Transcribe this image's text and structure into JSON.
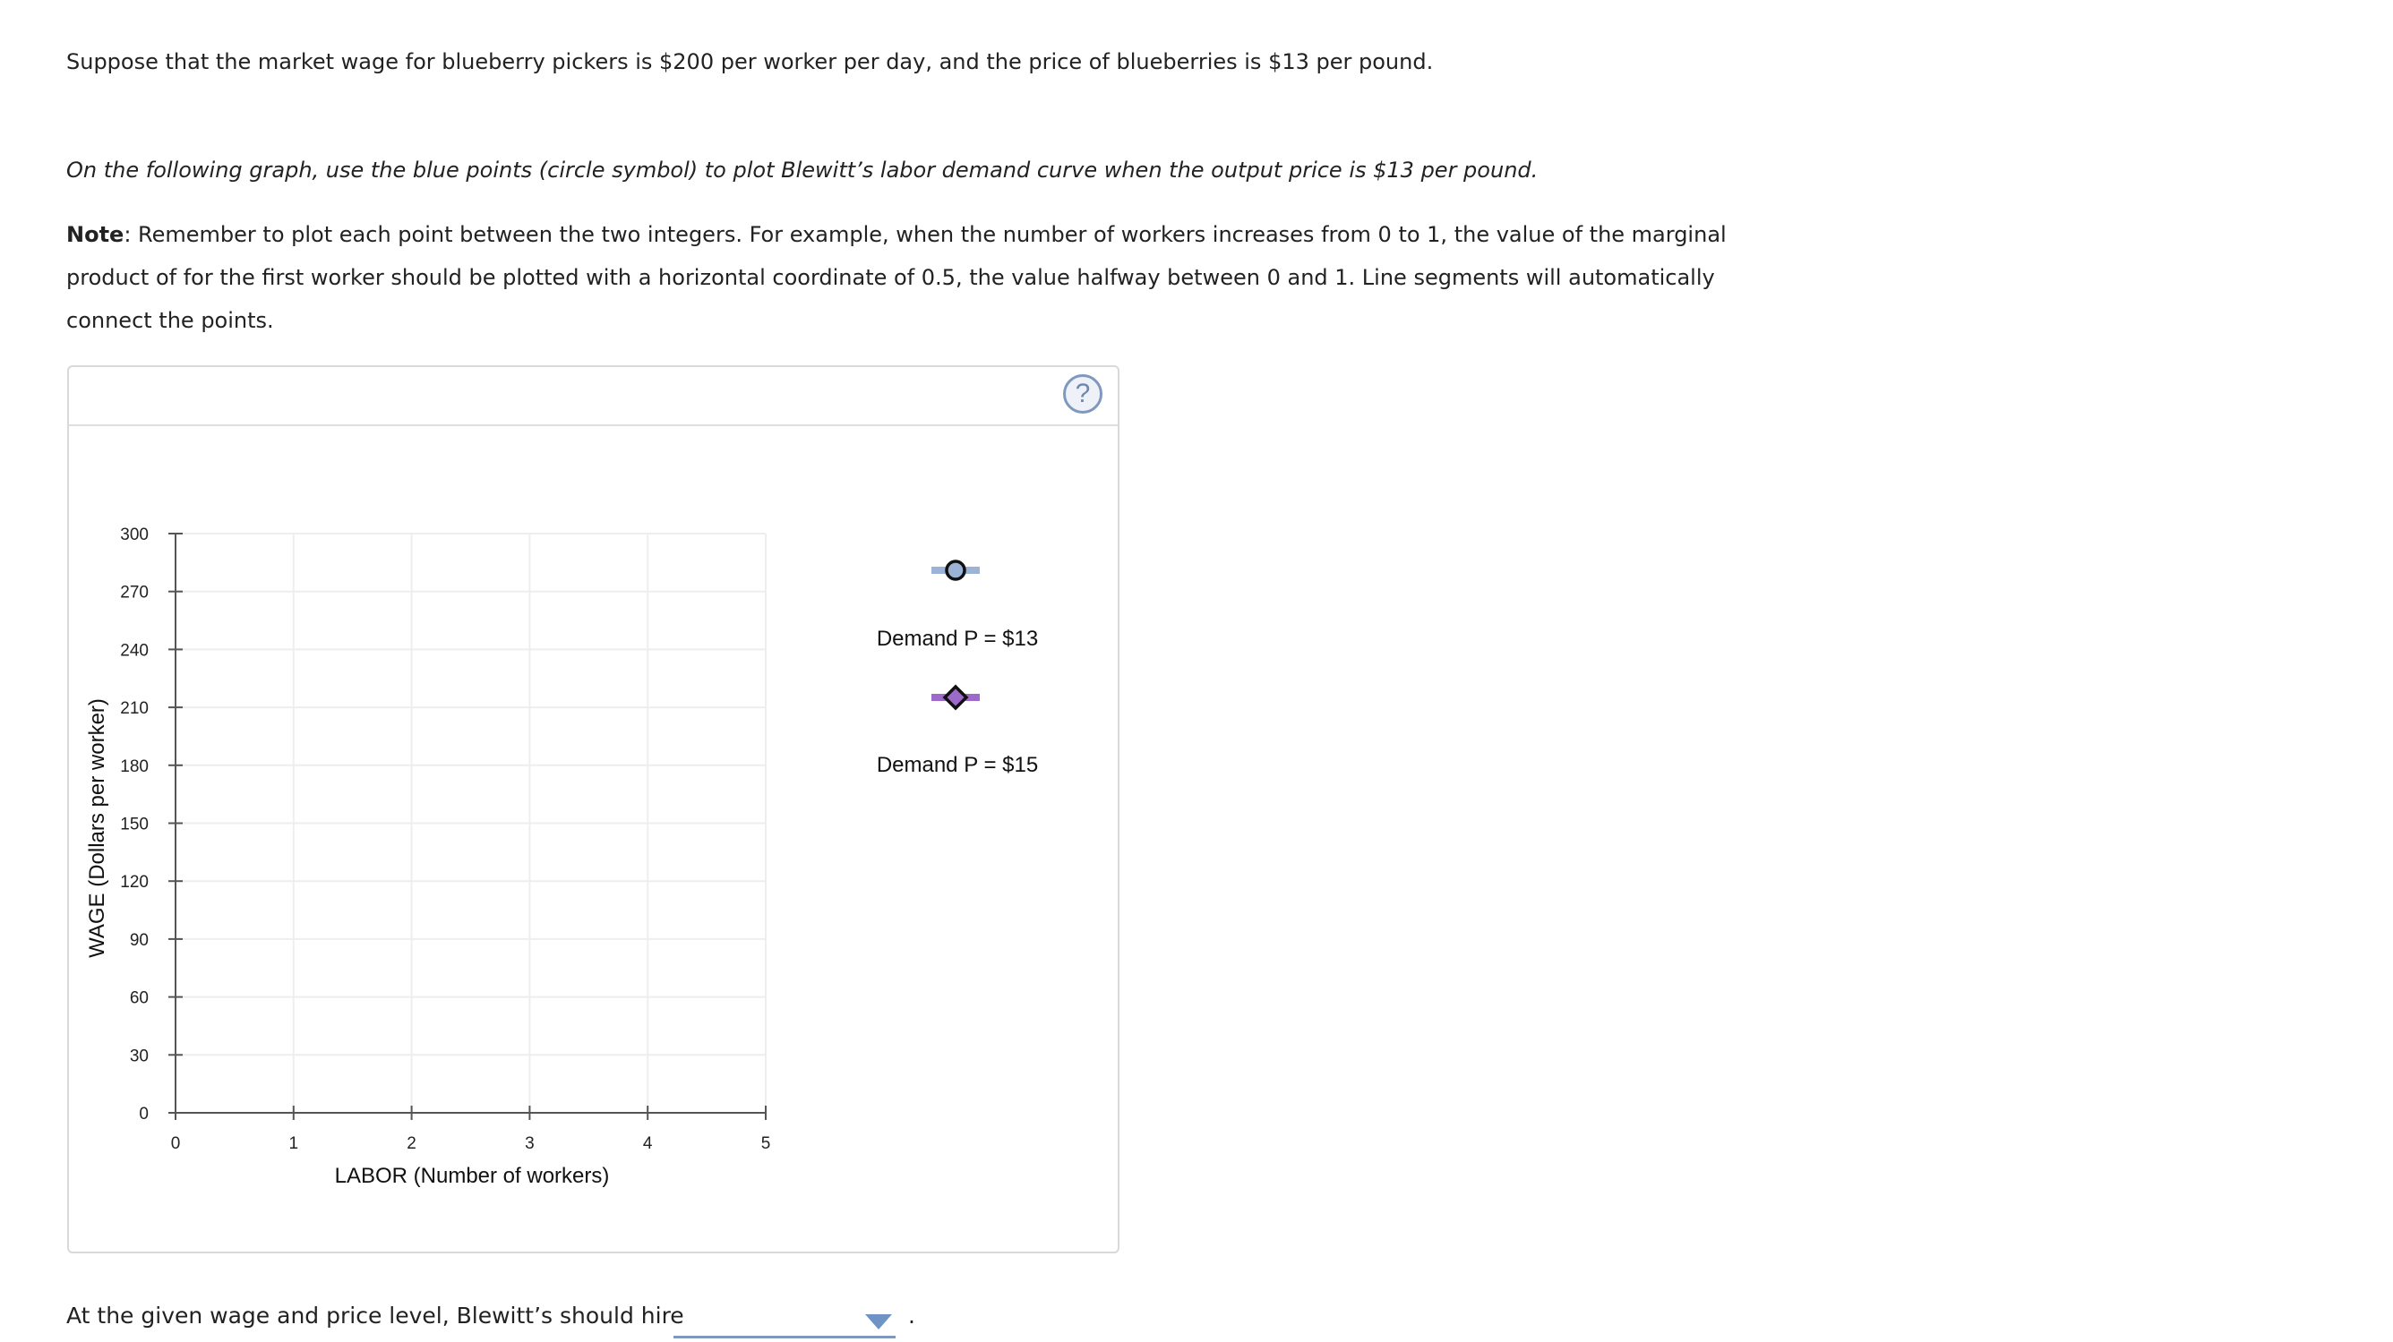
{
  "intro": {
    "sentence": "Suppose that the market wage for blueberry pickers is $200 per worker per day, and the price of blueberries is $13 per pound.",
    "instruction": "On the following graph, use the blue points (circle symbol) to plot Blewitt’s labor demand curve when the output price is $13 per pound.",
    "note_label": "Note",
    "note_text": ": Remember to plot each point between the two integers. For example, when the number of workers increases from 0 to 1, the value of the marginal product of for the first worker should be plotted with a horizontal coordinate of 0.5, the value halfway between 0 and 1. Line segments will automatically connect the points."
  },
  "help": {
    "icon": "question-circle-icon",
    "glyph": "?"
  },
  "chart_data": {
    "type": "line",
    "xlabel": "LABOR (Number of workers)",
    "ylabel": "WAGE (Dollars per worker)",
    "xlim": [
      0,
      5
    ],
    "ylim": [
      0,
      300
    ],
    "x_ticks": [
      0,
      1,
      2,
      3,
      4,
      5
    ],
    "y_ticks": [
      0,
      30,
      60,
      90,
      120,
      150,
      180,
      210,
      240,
      270,
      300
    ],
    "grid": true,
    "legend_position": "right",
    "series": [
      {
        "name": "Demand P = $13",
        "marker": "circle",
        "color": "#9ab3d6",
        "points": []
      },
      {
        "name": "Demand P = $15",
        "marker": "diamond",
        "color": "#9d6ac9",
        "points": []
      }
    ]
  },
  "colors": {
    "accent": "#7e98be",
    "circle_marker": "#9ab3d6",
    "diamond_marker": "#9d6ac9"
  },
  "question": {
    "text": "At the given wage and price level, Blewitt’s should hire",
    "selected_value": "",
    "trailing": "."
  }
}
